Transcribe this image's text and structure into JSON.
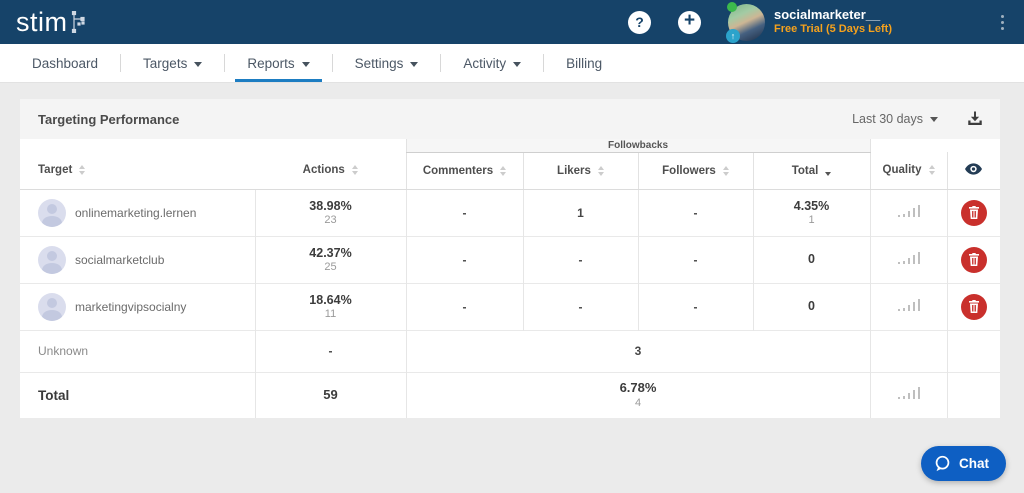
{
  "topbar": {
    "logo_text": "stim",
    "help_glyph": "?",
    "add_glyph": "+",
    "up_badge_glyph": "↑",
    "user": {
      "name": "socialmarketer__",
      "trial": "Free Trial (5 Days Left)"
    }
  },
  "nav": {
    "items": [
      {
        "label": "Dashboard"
      },
      {
        "label": "Targets"
      },
      {
        "label": "Reports"
      },
      {
        "label": "Settings"
      },
      {
        "label": "Activity"
      },
      {
        "label": "Billing"
      }
    ]
  },
  "panel": {
    "title": "Targeting Performance",
    "range_label": "Last 30 days"
  },
  "table": {
    "group_header": "Followbacks",
    "columns": [
      "Target",
      "Actions",
      "Commenters",
      "Likers",
      "Followers",
      "Total",
      "Quality"
    ],
    "rows": [
      {
        "target": "onlinemarketing.lernen",
        "actions_pct": "38.98%",
        "actions_count": "23",
        "commenters": "-",
        "likers": "1",
        "followers": "-",
        "total_pct": "4.35%",
        "total_count": "1"
      },
      {
        "target": "socialmarketclub",
        "actions_pct": "42.37%",
        "actions_count": "25",
        "commenters": "-",
        "likers": "-",
        "followers": "-",
        "total_pct": "0",
        "total_count": ""
      },
      {
        "target": "marketingvipsocialny",
        "actions_pct": "18.64%",
        "actions_count": "11",
        "commenters": "-",
        "likers": "-",
        "followers": "-",
        "total_pct": "0",
        "total_count": ""
      }
    ],
    "unknown_row": {
      "label": "Unknown",
      "actions": "-",
      "followbacks": "3"
    },
    "total_row": {
      "label": "Total",
      "actions": "59",
      "followbacks_pct": "6.78%",
      "followbacks_count": "4"
    }
  },
  "chat": {
    "label": "Chat"
  },
  "icons": {
    "logo_mark": "branch-dots",
    "download": "tray-down-arrow",
    "visibility": "eye",
    "delete": "trash",
    "quality": "signal-bars",
    "chat": "speech-bubble"
  },
  "colors": {
    "navy": "#164369",
    "accent_blue": "#1d7dc2",
    "trial_orange": "#f6a21d",
    "delete_red": "#c9302c",
    "chat_blue": "#0e5fc3"
  }
}
